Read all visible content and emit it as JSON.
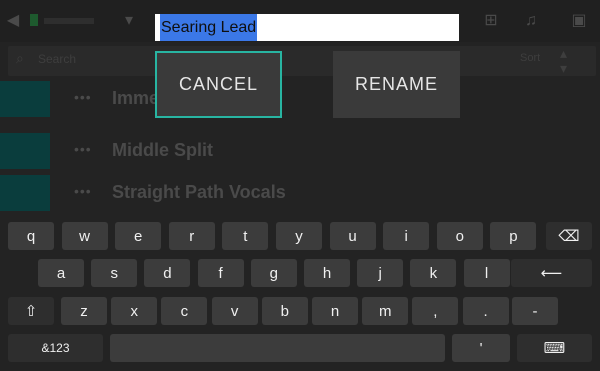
{
  "app": {
    "search_placeholder": "Search",
    "sort_label": "Sort",
    "rows": [
      {
        "dots": "•••",
        "name": "Immersive Wide"
      },
      {
        "dots": "•••",
        "name": "Middle Split"
      },
      {
        "dots": "•••",
        "name": "Straight Path Vocals"
      }
    ]
  },
  "dialog": {
    "input_value": "Searing Lead",
    "cancel_label": "CANCEL",
    "rename_label": "RENAME"
  },
  "keyboard": {
    "row1": [
      "q",
      "w",
      "e",
      "r",
      "t",
      "y",
      "u",
      "i",
      "o",
      "p"
    ],
    "row2": [
      "a",
      "s",
      "d",
      "f",
      "g",
      "h",
      "j",
      "k",
      "l"
    ],
    "row3": [
      "z",
      "x",
      "c",
      "v",
      "b",
      "n",
      "m",
      ",",
      "."
    ],
    "backspace_glyph": "⌫",
    "enter_glyph": "⟵",
    "shift_glyph": "⇧",
    "dash_key": "-",
    "symbols_label": "&123",
    "apostrophe_key": "'",
    "keyboard_glyph": "⌨"
  },
  "colors": {
    "accent": "#28b5a2",
    "selection": "#3b78e7",
    "key": "#3c3c3c"
  }
}
